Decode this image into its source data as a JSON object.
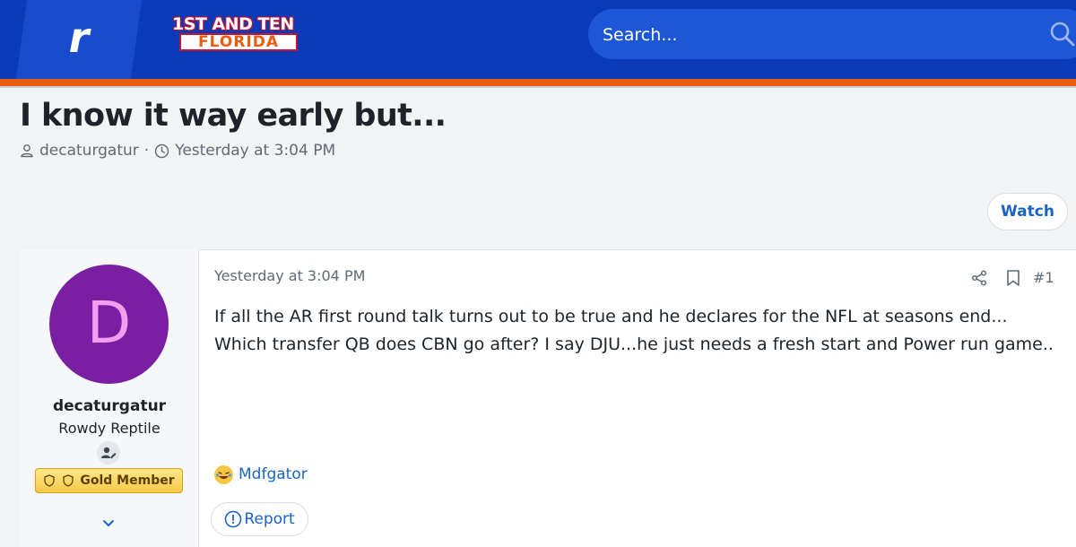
{
  "header": {
    "app_letter": "r",
    "logo_line1": "1ST AND TEN",
    "logo_line2": "FLORIDA",
    "search_placeholder": "Search..."
  },
  "thread": {
    "title": "I know it way early but...",
    "author": "decaturgatur",
    "separator": "·",
    "started": "Yesterday at 3:04 PM",
    "watch_label": "Watch"
  },
  "post": {
    "avatar_letter": "D",
    "username": "decaturgatur",
    "user_title": "Rowdy Reptile",
    "member_badge": "Gold Member",
    "timestamp": "Yesterday at 3:04 PM",
    "post_number": "#1",
    "body": "If all the AR first round talk turns out to be true and he declares for the NFL at seasons end... Which transfer QB does CBN go after? I say DJU...he just needs a fresh start and Power run game..",
    "reaction_user": "Mdfgator",
    "report_label": "Report"
  },
  "icons": {
    "search": "search-icon",
    "user": "user-icon",
    "clock": "clock-icon",
    "share": "share-icon",
    "bookmark": "bookmark-icon",
    "report": "alert-circle-icon",
    "expand": "chevron-down-icon",
    "reaction": "laugh-emoji-icon"
  },
  "colors": {
    "header_bg": "#0a3ab8",
    "accent_stripe": "#e85d12",
    "link": "#1a63c4",
    "avatar_bg": "#7a1fa2",
    "gold_badge": "#f7c948"
  }
}
